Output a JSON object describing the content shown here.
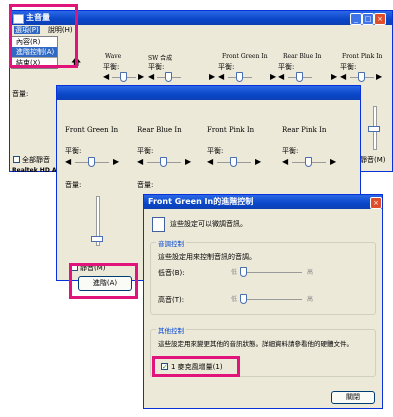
{
  "main_window": {
    "title": "主音量",
    "menu": {
      "options": "選項(P)",
      "help": "說明(H)"
    },
    "columns": [
      "Wave",
      "SW 合成",
      "Front Green In",
      "Rear Blue In",
      "Front Pink In"
    ],
    "balance_label": "平衡:",
    "volume_label": "音量:",
    "mute_all_label": "全部靜音",
    "mute_label": "靜音(M)",
    "status": "Realtek HD Au"
  },
  "options_menu": {
    "items": [
      "內容(R)",
      "進階控制(A)",
      "結束(X)"
    ]
  },
  "record_window": {
    "columns": [
      "Front Green In",
      "Rear Blue In",
      "Front Pink In",
      "Rear Pink In"
    ],
    "balance_label": "平衡:",
    "volume_label": "音量:",
    "mute_label": "靜音(M)",
    "advanced_button": "進階(A)"
  },
  "advanced_dialog": {
    "title": "Front Green In的進階控制",
    "intro": "這些設定可以微調音訊。",
    "tone_group": {
      "title": "音調控制",
      "desc": "這些設定用來控制音訊的音調。",
      "bass_label": "低音(B):",
      "treble_label": "高音(T):",
      "low": "低",
      "high": "高"
    },
    "other_group": {
      "title": "其他控制",
      "desc": "這些設定用來變更其他的音訊狀態。詳細資料請參看他的硬體文件。",
      "checkbox_label": "1 麥克風增量(1)",
      "checkbox_checked": true
    },
    "close_button": "關閉"
  },
  "colors": {
    "highlight": "#e0147a",
    "titlebar": "#0a47c8",
    "window_bg": "#ece9d8"
  }
}
